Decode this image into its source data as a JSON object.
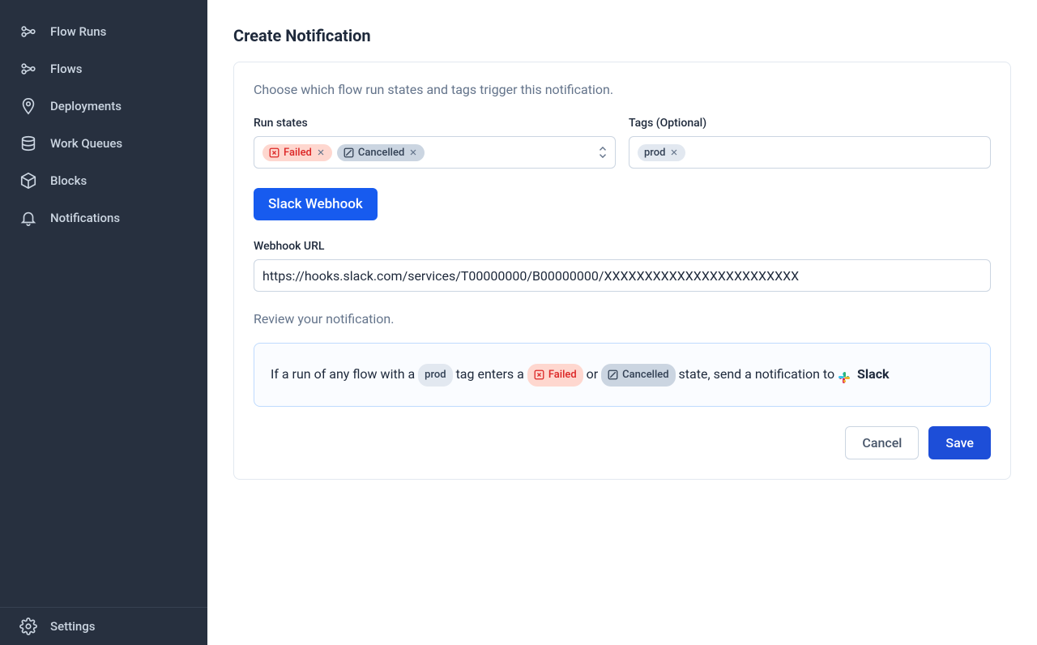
{
  "sidebar": {
    "items": [
      {
        "label": "Flow Runs",
        "name": "sidebar-item-flow-runs"
      },
      {
        "label": "Flows",
        "name": "sidebar-item-flows"
      },
      {
        "label": "Deployments",
        "name": "sidebar-item-deployments"
      },
      {
        "label": "Work Queues",
        "name": "sidebar-item-work-queues"
      },
      {
        "label": "Blocks",
        "name": "sidebar-item-blocks"
      },
      {
        "label": "Notifications",
        "name": "sidebar-item-notifications"
      }
    ],
    "bottom": {
      "label": "Settings",
      "name": "sidebar-item-settings"
    }
  },
  "page": {
    "title": "Create Notification",
    "description": "Choose which flow run states and tags trigger this notification.",
    "run_states_label": "Run states",
    "tags_label": "Tags (Optional)",
    "states": [
      {
        "label": "Failed",
        "kind": "failed"
      },
      {
        "label": "Cancelled",
        "kind": "cancelled"
      }
    ],
    "tags": [
      {
        "label": "prod"
      }
    ],
    "block_label": "Slack Webhook",
    "webhook_label": "Webhook URL",
    "webhook_value": "https://hooks.slack.com/services/T00000000/B00000000/XXXXXXXXXXXXXXXXXXXXXXXX",
    "review_label": "Review your notification.",
    "review": {
      "prefix": "If a run of any flow with a ",
      "tag": "prod",
      "mid1": " tag enters a ",
      "state1": "Failed",
      "or": " or ",
      "state2": "Cancelled",
      "mid2": " state, send a notification to ",
      "target": "Slack"
    },
    "cancel": "Cancel",
    "save": "Save"
  }
}
